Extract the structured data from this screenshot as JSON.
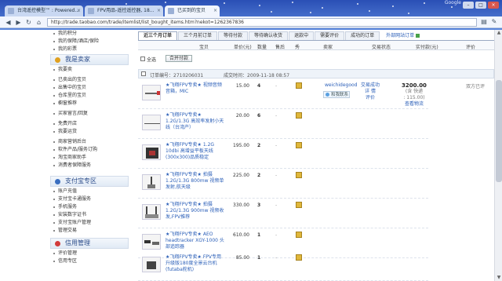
{
  "browser": {
    "tabs": [
      {
        "title": "台湾遥控模型™ : Powered..."
      },
      {
        "title": "FPV用品-遥控遥控器, 18..."
      },
      {
        "title": "已买到的宝贝"
      }
    ],
    "active_tab": 2,
    "google_label": "Google",
    "url": "http://trade.taobao.com/trade/itemlist/list_bought_items.htm?nekot=1262367836",
    "nav_icons": [
      "back-arrow-icon",
      "forward-arrow-icon",
      "reload-icon",
      "home-icon"
    ]
  },
  "sidebar": {
    "group1": [
      "我的积分",
      "我的保障/酒店/保险",
      "我的彩票"
    ],
    "seller_header": "我是卖家",
    "seller_items": [
      "我要卖",
      "已卖出的宝贝",
      "出售中的宝贝",
      "仓库里的宝贝",
      "橱窗推荐",
      "买家留言/回复",
      "免费开店",
      "我要运货",
      "商家营销后台",
      "软件产品/服务订购",
      "淘宝商家助手",
      "消费者保障服务"
    ],
    "alipay_header": "支付宝专区",
    "alipay_items": [
      "账户充值",
      "支付宝卡通服务",
      "手机服务",
      "安装数字证书",
      "支付宝账户管理",
      "管理交易"
    ],
    "credit_header": "信用管理",
    "credit_items": [
      "评价管理",
      "信用专区"
    ],
    "colors": {
      "seller": "#e0a020",
      "alipay": "#3a6ec0",
      "credit": "#d23b3b"
    }
  },
  "main": {
    "tabs": [
      "近三个月订单",
      "三个月前订单",
      "等待付款",
      "等待确认收货",
      "退款中",
      "需要评价",
      "成功的订单"
    ],
    "active_tab": 0,
    "special_tab": "外部网站订单",
    "columns": [
      "宝贝",
      "单价(元)",
      "数量",
      "售后",
      "秀",
      "卖家",
      "交易状态",
      "实付款(元)",
      "评价"
    ],
    "select_all_label": "全选",
    "merge_pay_label": "合并付款",
    "order": {
      "id_label": "订单编号：2710206031",
      "time_label": "成交时间：2009-11-18 08:57",
      "seller": "weichidegood",
      "wangwang_label": "和我联系",
      "status": [
        "交易成功",
        "详 情",
        "评价"
      ],
      "amount": "3200.00",
      "amount_detail": [
        "(含 快递",
        ": 115.00)"
      ],
      "snapshot": "查看物流",
      "rate": "双方已评"
    },
    "items": [
      {
        "name": "★飞翔FPV专卖★ 视频音频音箱，MIC",
        "price": "15.00",
        "qty": "4",
        "extra": "-"
      },
      {
        "name": "★飞翔FPV专卖★ 1.2G/1.3G 高效率发射小天线（台湾产）",
        "price": "20.00",
        "qty": "6",
        "extra": "-"
      },
      {
        "name": "★飞翔FPV专卖★ 1.2G 10dbi 高增益平板天线(300x300)品质稳定",
        "price": "195.00",
        "qty": "2",
        "extra": "-"
      },
      {
        "name": "★飞翔FPV专卖★ 拍摄 1.2G/1.3G 800mw 视频单发射,航天级",
        "price": "225.00",
        "qty": "2",
        "extra": "-"
      },
      {
        "name": "★飞翔FPV专卖★ 拍摄 1.2G/1.3G 900mw 视频收发,FPV推荐",
        "price": "330.00",
        "qty": "3",
        "extra": "-"
      },
      {
        "name": "★飞翔FPV专卖★ AEO headtracker XGY-1000 头部追踪器",
        "price": "610.00",
        "qty": "1",
        "extra": "-"
      },
      {
        "name": "★飞翔FPV专卖★ FPV专用升级版180度全景云台机 (futaba舵机)",
        "price": "85.00",
        "qty": "1",
        "extra": "-"
      }
    ]
  }
}
